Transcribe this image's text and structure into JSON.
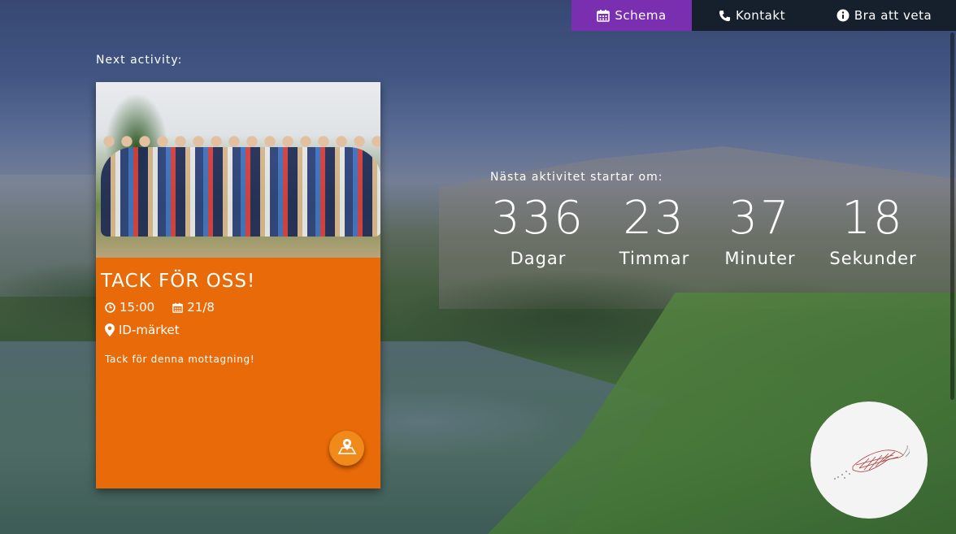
{
  "nav": {
    "items": [
      {
        "label": "Schema",
        "icon": "calendar-icon",
        "active": true
      },
      {
        "label": "Kontakt",
        "icon": "phone-icon",
        "active": false
      },
      {
        "label": "Bra att veta",
        "icon": "info-icon",
        "active": false
      }
    ]
  },
  "next_activity_label": "Next activity:",
  "activity": {
    "title": "TACK FÖR OSS!",
    "time": "15:00",
    "date": "21/8",
    "location": "ID-märket",
    "description": "Tack för denna mottagning!"
  },
  "countdown": {
    "label": "Nästa aktivitet startar om:",
    "days": "336",
    "days_label": "Dagar",
    "hours": "23",
    "hours_label": "Timmar",
    "minutes": "37",
    "minutes_label": "Minuter",
    "seconds": "18",
    "seconds_label": "Sekunder"
  },
  "colors": {
    "nav_active": "#7a2fb0",
    "nav_bg": "#16202c",
    "card": "#e96a08",
    "map_button": "#f08a1a"
  }
}
